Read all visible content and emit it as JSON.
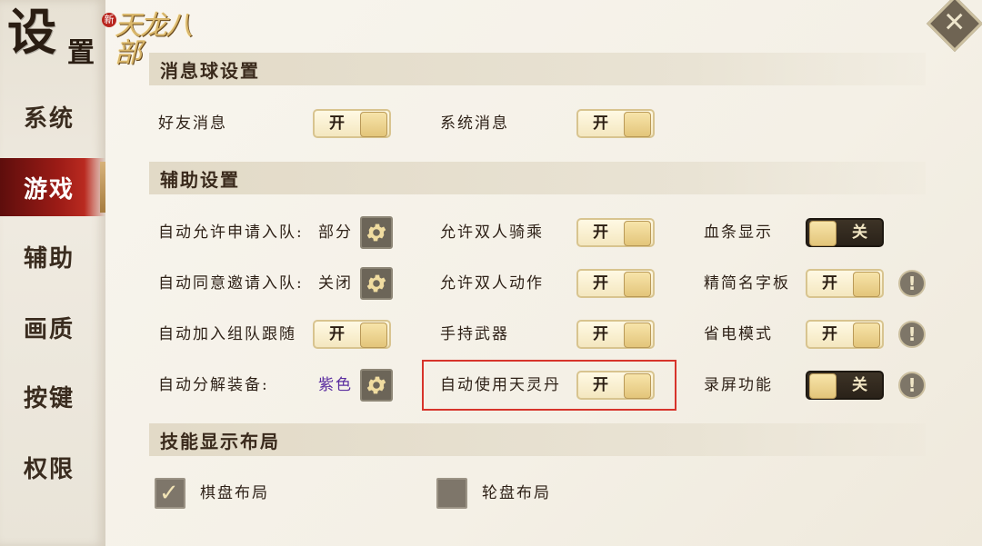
{
  "sidebar": {
    "title_big": "设",
    "title_small": "置",
    "logo_badge": "新",
    "logo_text": "天龙八部",
    "items": [
      {
        "label": "系统",
        "active": false
      },
      {
        "label": "游戏",
        "active": true
      },
      {
        "label": "辅助",
        "active": false
      },
      {
        "label": "画质",
        "active": false
      },
      {
        "label": "按键",
        "active": false
      },
      {
        "label": "权限",
        "active": false
      }
    ]
  },
  "close_glyph": "✕",
  "sections": {
    "message_ball": {
      "title": "消息球设置",
      "friend_msg": {
        "label": "好友消息",
        "state": "开"
      },
      "system_msg": {
        "label": "系统消息",
        "state": "开"
      }
    },
    "assist": {
      "title": "辅助设置",
      "auto_allow_team": {
        "label": "自动允许申请入队:",
        "value": "部分"
      },
      "auto_agree_invite": {
        "label": "自动同意邀请入队:",
        "value": "关闭"
      },
      "auto_join_follow": {
        "label": "自动加入组队跟随",
        "state": "开"
      },
      "auto_decompose": {
        "label": "自动分解装备:",
        "value": "紫色"
      },
      "allow_double_ride": {
        "label": "允许双人骑乘",
        "state": "开"
      },
      "allow_double_action": {
        "label": "允许双人动作",
        "state": "开"
      },
      "hold_weapon": {
        "label": "手持武器",
        "state": "开"
      },
      "auto_use_pill": {
        "label": "自动使用天灵丹",
        "state": "开"
      },
      "hp_bar": {
        "label": "血条显示",
        "state": "关"
      },
      "simple_nameplate": {
        "label": "精简名字板",
        "state": "开"
      },
      "power_save": {
        "label": "省电模式",
        "state": "开"
      },
      "screen_record": {
        "label": "录屏功能",
        "state": "关"
      },
      "info_glyph": "!"
    },
    "skill_layout": {
      "title": "技能显示布局",
      "chessboard": {
        "label": "棋盘布局",
        "checked": true
      },
      "wheel": {
        "label": "轮盘布局",
        "checked": false
      },
      "tick_glyph": "✓"
    }
  },
  "colors": {
    "accent_red": "#9b1b16",
    "highlight_border": "#d7342b",
    "purple_value": "#5b2ea0",
    "toggle_on_bg": "#f4e7bf",
    "toggle_off_bg": "#2a2219"
  }
}
